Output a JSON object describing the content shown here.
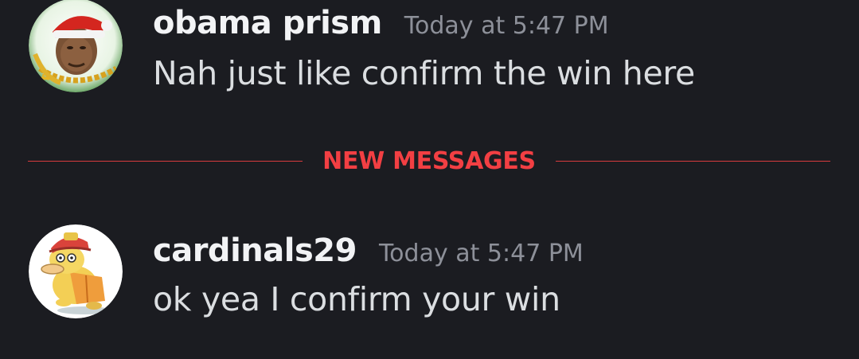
{
  "messages": [
    {
      "username": "obama prism",
      "timestamp": "Today at 5:47 PM",
      "text": "Nah just like confirm the win here"
    },
    {
      "username": "cardinals29",
      "timestamp": "Today at 5:47 PM",
      "text": "ok yea I confirm your win"
    }
  ],
  "divider": {
    "label": "NEW MESSAGES",
    "color": "#f23f43"
  },
  "colors": {
    "background": "#1b1c21",
    "username": "#f2f3f5",
    "timestamp": "#8d9099",
    "message_text": "#dbdee1"
  }
}
